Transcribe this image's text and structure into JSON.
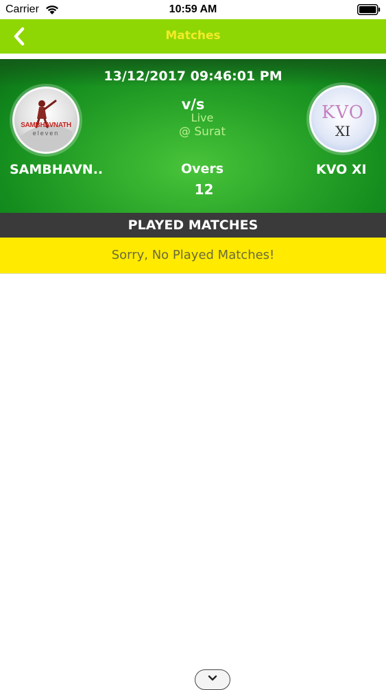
{
  "status_bar": {
    "carrier": "Carrier",
    "time": "10:59 AM"
  },
  "nav": {
    "title": "Matches",
    "back_icon": "chevron-left-icon",
    "bar_color": "#8fd704",
    "title_color": "#f4ea2a"
  },
  "match": {
    "datetime": "13/12/2017 09:46:01 PM",
    "vs": "v/s",
    "status": "Live",
    "venue": "@ Surat",
    "overs_label": "Overs",
    "overs": "12",
    "team1": {
      "name": "SAMBHAVN..",
      "logo_text": "SAMBHAVNATH",
      "logo_subtext": "eleven"
    },
    "team2": {
      "name": "KVO XI",
      "logo_text_line1": "KVO",
      "logo_text_line2": "XI"
    }
  },
  "played_matches": {
    "header": "PLAYED MATCHES",
    "empty_message": "Sorry, No Played Matches!",
    "banner_color": "#ffea00"
  },
  "bottom_handle_icon": "chevron-down-icon"
}
